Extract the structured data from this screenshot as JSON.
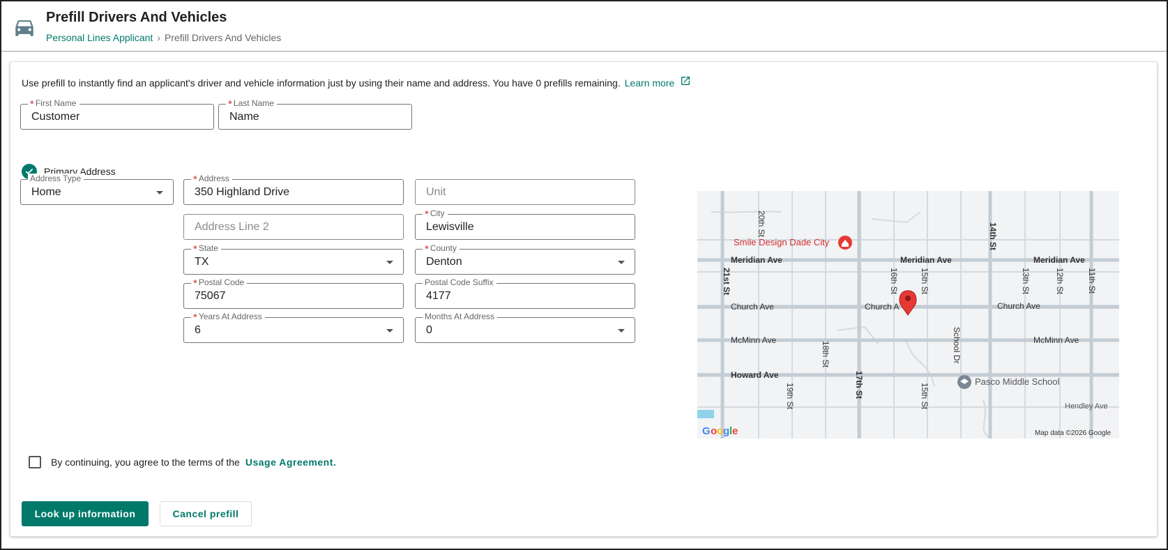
{
  "header": {
    "title": "Prefill Drivers And Vehicles",
    "breadcrumb": {
      "parent": "Personal Lines Applicant",
      "separator": "›",
      "current": "Prefill Drivers And Vehicles"
    },
    "icon": "car-icon"
  },
  "intro": {
    "text": "Use prefill to instantly find an applicant's driver and vehicle information just by using their name and address. You have 0 prefills remaining.",
    "learn_more": "Learn more",
    "learn_more_icon": "external-link-icon"
  },
  "name": {
    "first": {
      "label": "First Name",
      "value": "Customer",
      "required": true
    },
    "last": {
      "label": "Last Name",
      "value": "Name",
      "required": true
    }
  },
  "primary_address": {
    "label": "Primary Address",
    "checked": true
  },
  "address": {
    "type": {
      "label": "Address Type",
      "value": "Home"
    },
    "line1": {
      "label": "Address",
      "value": "350 Highland Drive"
    },
    "unit": {
      "placeholder": "Unit"
    },
    "line2": {
      "placeholder": "Address Line 2"
    },
    "city": {
      "label": "City",
      "value": "Lewisville"
    },
    "state": {
      "label": "State",
      "value": "TX"
    },
    "county": {
      "label": "County",
      "value": "Denton"
    },
    "postal_code": {
      "label": "Postal Code",
      "value": "75067"
    },
    "postal_suffix": {
      "label": "Postal Code Suffix",
      "value": "4177"
    },
    "years": {
      "label": "Years At Address",
      "value": "6"
    },
    "months": {
      "label": "Months At Address",
      "value": "0"
    }
  },
  "map": {
    "attribution": "Map data ©2026 Google",
    "logo": "Google",
    "places": {
      "smile": "Smile Design Dade City",
      "school": "Pasco Middle School"
    },
    "streets": {
      "meridian": "Meridian Ave",
      "church": "Church Ave",
      "church_short": "Church A",
      "mcminn": "McMinn Ave",
      "howard": "Howard Ave",
      "hendley": "Hendley Ave",
      "s20": "20th St",
      "s21": "21st St",
      "s19": "19th St",
      "s18": "18th St",
      "s17": "17th St",
      "s16": "16th St",
      "s15": "15th St",
      "s14": "14th St",
      "s13": "13th St",
      "s12": "12th St",
      "s11": "11th St",
      "school_dr": "School Dr"
    }
  },
  "agreement": {
    "text": "By continuing, you agree to the terms of the",
    "link": "Usage Agreement."
  },
  "actions": {
    "lookup": "Look up information",
    "cancel": "Cancel prefill"
  },
  "colors": {
    "accent": "#00796b",
    "required": "#d32f2f",
    "pin": "#e53935"
  }
}
